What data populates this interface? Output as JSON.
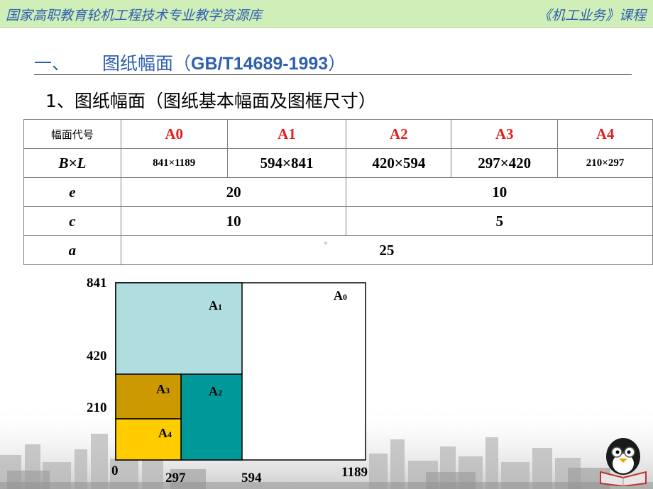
{
  "banner": {
    "left": "国家高职教育轮机工程技术专业教学资源库",
    "right": "《机工业务》课程"
  },
  "section": {
    "number": "一、",
    "title": "图纸幅面（",
    "code": "GB/T14689-1993",
    "close": "）"
  },
  "subtitle": "1、图纸幅面（图纸基本幅面及图框尺寸）",
  "table": {
    "header_label": "幅面代号",
    "formats": [
      "A0",
      "A1",
      "A2",
      "A3",
      "A4"
    ],
    "bl_label": "B×L",
    "bl_values": [
      "841×1189",
      "594×841",
      "420×594",
      "297×420",
      "210×297"
    ],
    "e_label": "e",
    "e_values": [
      "20",
      "10"
    ],
    "c_label": "c",
    "c_values": [
      "10",
      "5"
    ],
    "a_label": "a",
    "a_value": "25"
  },
  "diagram": {
    "y_ticks": [
      "841",
      "420",
      "210"
    ],
    "x_ticks": [
      "0",
      "297",
      "594",
      "1189"
    ],
    "regions": [
      {
        "label": "A",
        "sub": "0",
        "color": "#ffffff"
      },
      {
        "label": "A",
        "sub": "1",
        "color": "#b0dde0"
      },
      {
        "label": "A",
        "sub": "2",
        "color": "#009999"
      },
      {
        "label": "A",
        "sub": "3",
        "color": "#cc9900"
      },
      {
        "label": "A",
        "sub": "4",
        "color": "#ffcc00"
      }
    ]
  },
  "colors": {
    "banner_bg": "#cfeeb8",
    "title_blue": "#2f5fb0",
    "header_red": "#e0201c"
  }
}
